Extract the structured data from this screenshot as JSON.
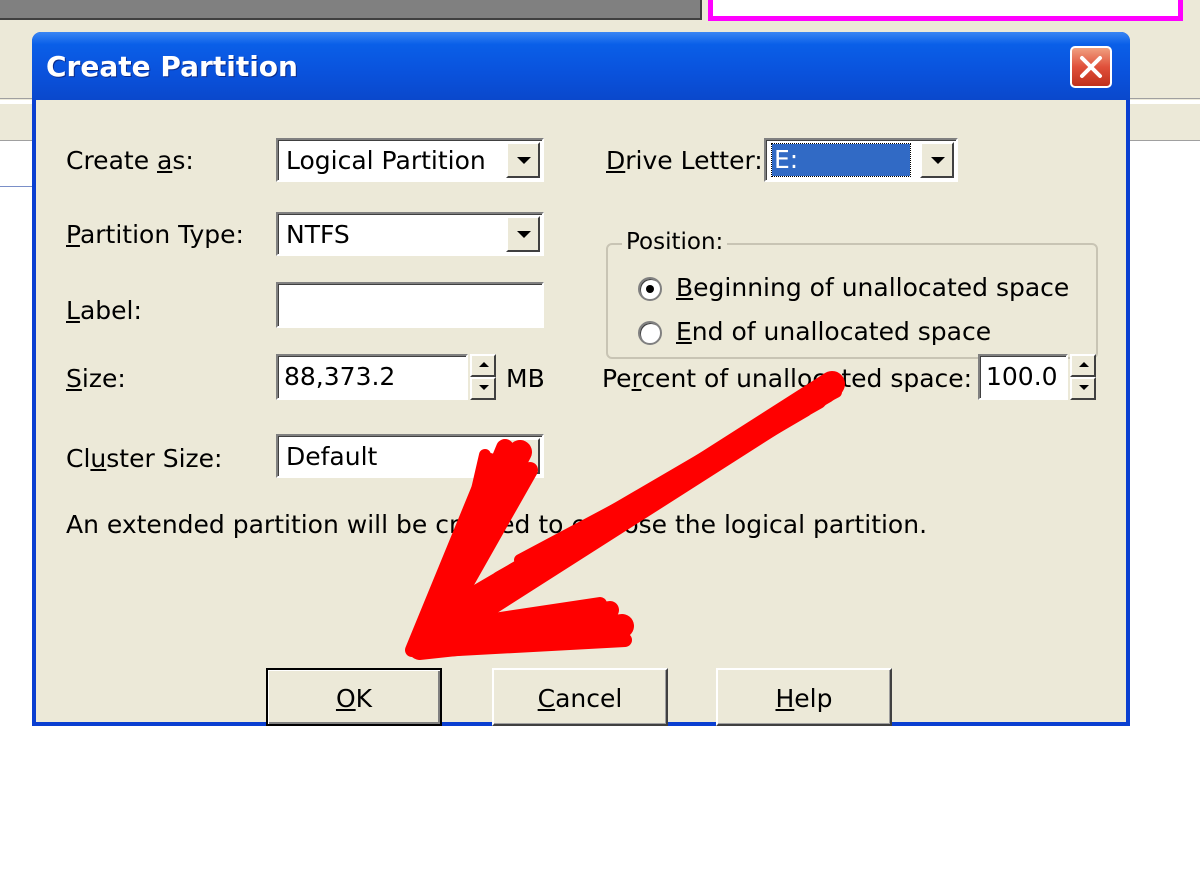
{
  "dialog": {
    "title": "Create Partition"
  },
  "fields": {
    "create_as": {
      "label_pre": "Create ",
      "label_key": "a",
      "label_post": "s:",
      "value": "Logical Partition"
    },
    "partition_type": {
      "label_key": "P",
      "label_post": "artition Type:",
      "value": "NTFS"
    },
    "label": {
      "label_key": "L",
      "label_post": "abel:",
      "value": ""
    },
    "size": {
      "label_key": "S",
      "label_post": "ize:",
      "value": "88,373.2",
      "unit": "MB"
    },
    "cluster_size": {
      "label_pre": "Cl",
      "label_key": "u",
      "label_post": "ster Size:",
      "value": "Default"
    },
    "drive_letter": {
      "label_key": "D",
      "label_post": "rive Letter:",
      "value": "E:"
    },
    "percent": {
      "label_pre": "Pe",
      "label_key": "r",
      "label_post": "cent of unallocated space:",
      "value": "100.0"
    }
  },
  "position": {
    "title": "Position:",
    "options": [
      {
        "key": "B",
        "rest": "eginning of unallocated space",
        "selected": true
      },
      {
        "key": "E",
        "rest": "nd of unallocated space",
        "selected": false
      }
    ]
  },
  "info_text": "An extended partition will be created to enclose the logical partition.",
  "buttons": {
    "ok": {
      "key": "O",
      "rest": "K"
    },
    "cancel": {
      "key": "C",
      "rest": "ancel"
    },
    "help": {
      "key": "H",
      "rest": "elp"
    }
  },
  "colors": {
    "titlebar": "#0a52dc",
    "selection": "#316ac5",
    "annotation_arrow": "#ff0000"
  },
  "icons": {
    "close": "close-icon",
    "dropdown": "chevron-down-icon",
    "spinner": "spinner-arrows-icon",
    "annotation": "red-arrow-icon"
  }
}
